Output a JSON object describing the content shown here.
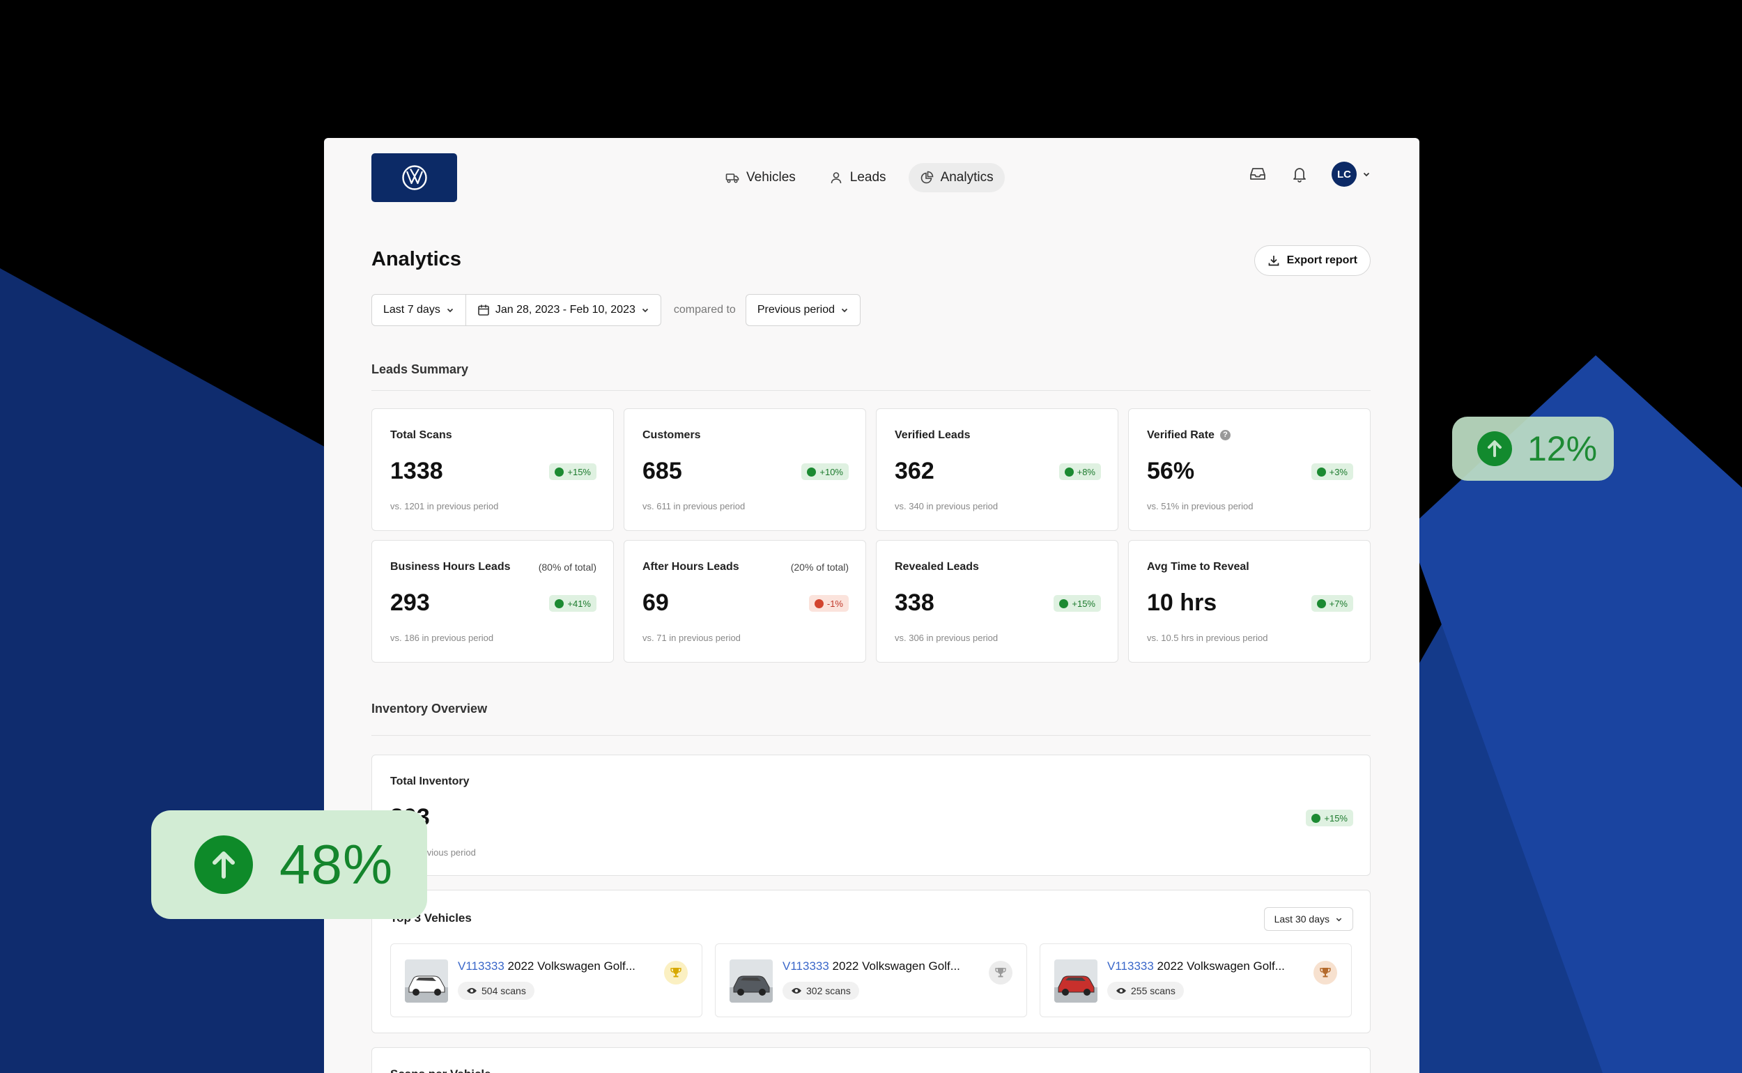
{
  "colors": {
    "brand": "#0c2a66",
    "positive": "#1c8a32",
    "negative": "#d2452f",
    "link": "#3a67c9"
  },
  "nav": {
    "items": [
      {
        "label": "Vehicles",
        "icon": "truck-icon"
      },
      {
        "label": "Leads",
        "icon": "user-icon"
      },
      {
        "label": "Analytics",
        "icon": "pie-chart-icon",
        "active": true
      }
    ]
  },
  "user": {
    "initials": "LC"
  },
  "page": {
    "title": "Analytics",
    "export_label": "Export report"
  },
  "filters": {
    "range": "Last 7 days",
    "dates": "Jan 28, 2023 - Feb 10, 2023",
    "compared_to": "compared to",
    "comparison": "Previous period"
  },
  "leads_summary": {
    "title": "Leads Summary",
    "cards": [
      {
        "label": "Total Scans",
        "sub": "",
        "value": "1338",
        "change": "+15%",
        "direction": "up",
        "note": "vs. 1201 in previous period"
      },
      {
        "label": "Customers",
        "sub": "",
        "value": "685",
        "change": "+10%",
        "direction": "up",
        "note": "vs. 611 in previous period"
      },
      {
        "label": "Verified Leads",
        "sub": "",
        "value": "362",
        "change": "+8%",
        "direction": "up",
        "note": "vs. 340 in previous period"
      },
      {
        "label": "Verified Rate",
        "sub": "",
        "value": "56%",
        "change": "+3%",
        "direction": "up",
        "note": "vs. 51% in previous period",
        "info": "?"
      },
      {
        "label": "Business Hours Leads",
        "sub": "(80% of total)",
        "value": "293",
        "change": "+41%",
        "direction": "up",
        "note": "vs. 186 in previous period"
      },
      {
        "label": "After Hours Leads",
        "sub": "(20% of total)",
        "value": "69",
        "change": "-1%",
        "direction": "down",
        "note": "vs. 71 in previous period"
      },
      {
        "label": "Revealed Leads",
        "sub": "",
        "value": "338",
        "change": "+15%",
        "direction": "up",
        "note": "vs. 306 in previous period"
      },
      {
        "label": "Avg Time to Reveal",
        "sub": "",
        "value": "10 hrs",
        "change": "+7%",
        "direction": "up",
        "note": "vs. 10.5 hrs in previous period"
      }
    ]
  },
  "inventory": {
    "title": "Inventory Overview",
    "total_label": "Total Inventory",
    "total_value": "303",
    "change": "+15%",
    "note": "vs. in previous period"
  },
  "top3": {
    "title": "Top 3 Vehicles",
    "period": "Last 30 days",
    "vehicles": [
      {
        "id": "V113333",
        "name": "2022 Volkswagen Golf...",
        "scans": "504 scans",
        "rank": "gold-trophy-icon",
        "color": "#ffffff"
      },
      {
        "id": "V113333",
        "name": "2022 Volkswagen Golf...",
        "scans": "302 scans",
        "rank": "silver-trophy-icon",
        "color": "#555a60"
      },
      {
        "id": "V113333",
        "name": "2022 Volkswagen Golf...",
        "scans": "255 scans",
        "rank": "bronze-trophy-icon",
        "color": "#c8302c"
      }
    ]
  },
  "scans_per_vehicle": {
    "title": "Scans per Vehicle"
  },
  "overlays": {
    "big": "48%",
    "small": "12%"
  }
}
